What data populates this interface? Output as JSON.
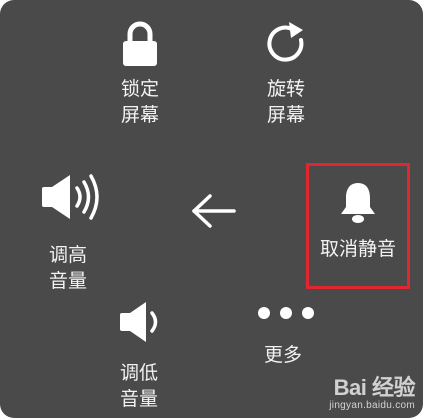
{
  "menu": {
    "lock": {
      "label": "锁定\n屏幕",
      "icon": "lock-icon"
    },
    "rotate": {
      "label": "旋转\n屏幕",
      "icon": "rotate-icon"
    },
    "volume_up": {
      "label": "调高\n音量",
      "icon": "volume-up-icon"
    },
    "back": {
      "icon": "back-arrow-icon"
    },
    "unmute": {
      "label": "取消静音",
      "icon": "bell-icon",
      "highlight_color": "#e0262f"
    },
    "volume_down": {
      "label": "调低\n音量",
      "icon": "volume-down-icon"
    },
    "more": {
      "label": "更多",
      "icon": "more-dots-icon"
    }
  },
  "watermark": {
    "main": "Bai 经验",
    "sub": "jingyan.baidu.com"
  },
  "colors": {
    "panel_background": "#4a4a4a",
    "foreground": "#ffffff"
  }
}
